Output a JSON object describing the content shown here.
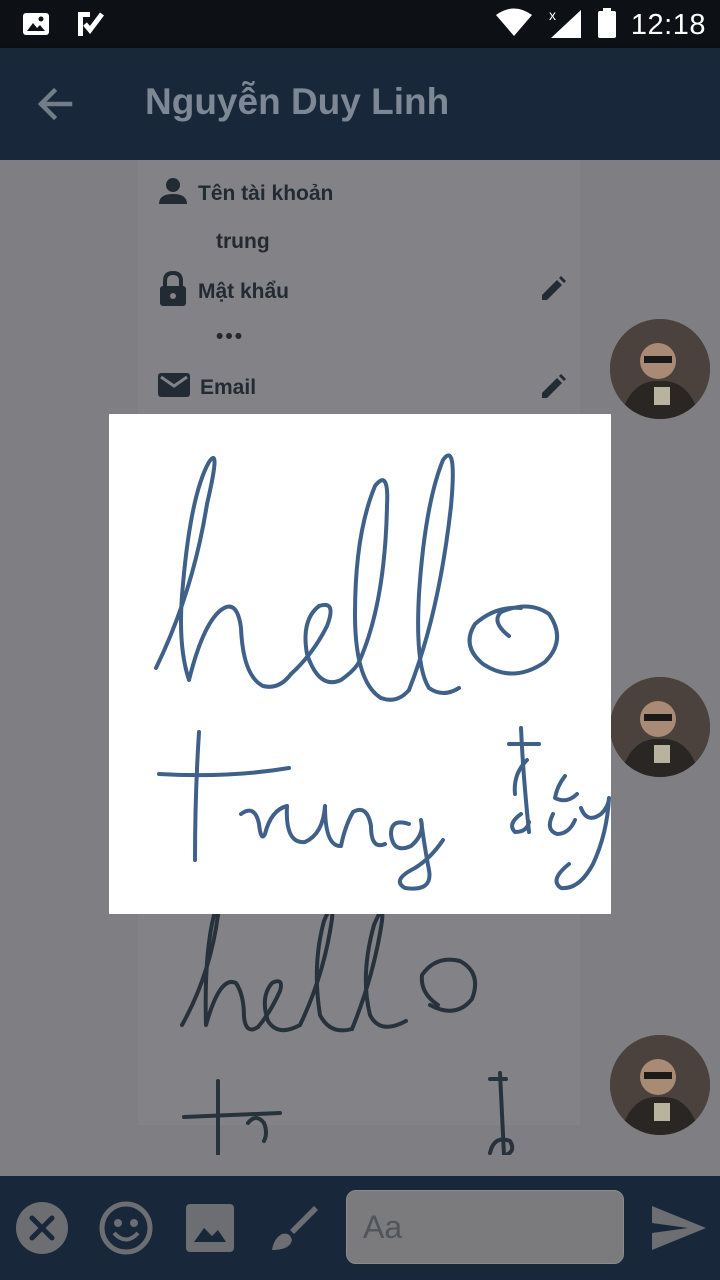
{
  "status_bar": {
    "time": "12:18",
    "icons": [
      "image-notification-icon",
      "checklist-notification-icon",
      "wifi-icon",
      "no-signal-icon",
      "battery-icon"
    ]
  },
  "app_bar": {
    "title": "Nguyễn Duy Linh",
    "back_icon": "arrow-back-icon"
  },
  "profile": {
    "username_label": "Tên tài khoản",
    "username_value": "trung",
    "password_label": "Mật khẩu",
    "password_value": "•••",
    "email_label": "Email"
  },
  "drawing": {
    "line1": "hello",
    "line2": "trung đây",
    "stroke_color": "#3f6189"
  },
  "input_bar": {
    "placeholder": "Aa",
    "icons": [
      "close-icon",
      "emoji-icon",
      "image-icon",
      "brush-icon",
      "send-icon"
    ]
  },
  "colors": {
    "app_bar": "#18283a",
    "status_bar": "#0d1015",
    "dim_background": "#7e7e83"
  }
}
